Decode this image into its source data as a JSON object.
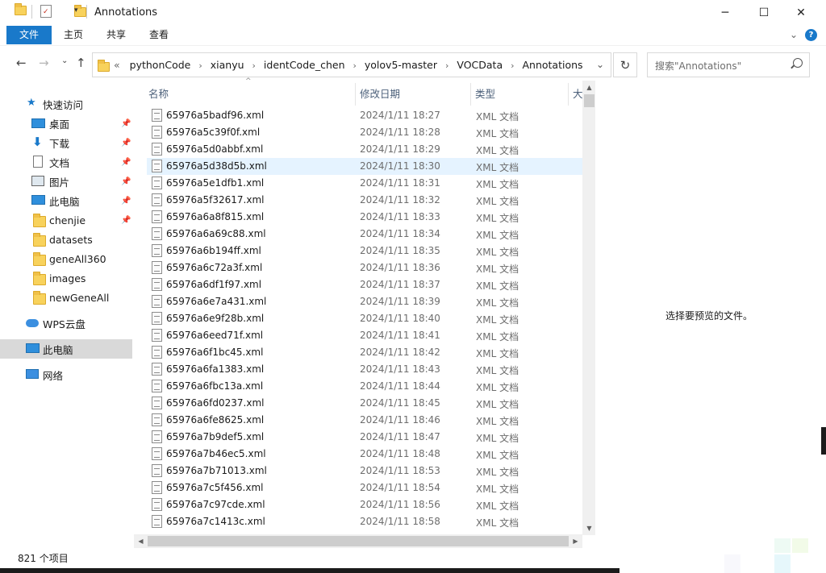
{
  "window": {
    "title": "Annotations",
    "minimize_icon": "─",
    "maximize_icon": "☐",
    "close_icon": "✕"
  },
  "ribbon": {
    "tabs": [
      "文件",
      "主页",
      "共享",
      "查看"
    ],
    "expand_icon": "⌄",
    "help_icon": "?"
  },
  "address": {
    "back_icon": "←",
    "forward_icon": "→",
    "recent_icon": "⌄",
    "up_icon": "↑",
    "overflow": "«",
    "crumbs": [
      "pythonCode",
      "xianyu",
      "identCode_chen",
      "yolov5-master",
      "VOCData",
      "Annotations"
    ],
    "dropdown_icon": "⌄",
    "refresh_icon": "↻"
  },
  "search": {
    "placeholder": "搜索\"Annotations\""
  },
  "nav": {
    "quick_access": "快速访问",
    "items": [
      {
        "label": "桌面",
        "pinned": true
      },
      {
        "label": "下载",
        "pinned": true
      },
      {
        "label": "文档",
        "pinned": true
      },
      {
        "label": "图片",
        "pinned": true
      },
      {
        "label": "此电脑",
        "pinned": true
      },
      {
        "label": "chenjie",
        "pinned": true
      },
      {
        "label": "datasets",
        "pinned": false
      },
      {
        "label": "geneAll360",
        "pinned": false
      },
      {
        "label": "images",
        "pinned": false
      },
      {
        "label": "newGeneAll",
        "pinned": false
      }
    ],
    "wps": "WPS云盘",
    "this_pc": "此电脑",
    "network": "网络",
    "pin_icon": "📌"
  },
  "columns": {
    "name": "名称",
    "date": "修改日期",
    "type": "类型",
    "size": "大"
  },
  "files": [
    {
      "name": "65976a5badf96.xml",
      "date": "2024/1/11 18:27",
      "type": "XML 文档"
    },
    {
      "name": "65976a5c39f0f.xml",
      "date": "2024/1/11 18:28",
      "type": "XML 文档"
    },
    {
      "name": "65976a5d0abbf.xml",
      "date": "2024/1/11 18:29",
      "type": "XML 文档"
    },
    {
      "name": "65976a5d38d5b.xml",
      "date": "2024/1/11 18:30",
      "type": "XML 文档",
      "highlight": true
    },
    {
      "name": "65976a5e1dfb1.xml",
      "date": "2024/1/11 18:31",
      "type": "XML 文档"
    },
    {
      "name": "65976a5f32617.xml",
      "date": "2024/1/11 18:32",
      "type": "XML 文档"
    },
    {
      "name": "65976a6a8f815.xml",
      "date": "2024/1/11 18:33",
      "type": "XML 文档"
    },
    {
      "name": "65976a6a69c88.xml",
      "date": "2024/1/11 18:34",
      "type": "XML 文档"
    },
    {
      "name": "65976a6b194ff.xml",
      "date": "2024/1/11 18:35",
      "type": "XML 文档"
    },
    {
      "name": "65976a6c72a3f.xml",
      "date": "2024/1/11 18:36",
      "type": "XML 文档"
    },
    {
      "name": "65976a6df1f97.xml",
      "date": "2024/1/11 18:37",
      "type": "XML 文档"
    },
    {
      "name": "65976a6e7a431.xml",
      "date": "2024/1/11 18:39",
      "type": "XML 文档"
    },
    {
      "name": "65976a6e9f28b.xml",
      "date": "2024/1/11 18:40",
      "type": "XML 文档"
    },
    {
      "name": "65976a6eed71f.xml",
      "date": "2024/1/11 18:41",
      "type": "XML 文档"
    },
    {
      "name": "65976a6f1bc45.xml",
      "date": "2024/1/11 18:42",
      "type": "XML 文档"
    },
    {
      "name": "65976a6fa1383.xml",
      "date": "2024/1/11 18:43",
      "type": "XML 文档"
    },
    {
      "name": "65976a6fbc13a.xml",
      "date": "2024/1/11 18:44",
      "type": "XML 文档"
    },
    {
      "name": "65976a6fd0237.xml",
      "date": "2024/1/11 18:45",
      "type": "XML 文档"
    },
    {
      "name": "65976a6fe8625.xml",
      "date": "2024/1/11 18:46",
      "type": "XML 文档"
    },
    {
      "name": "65976a7b9def5.xml",
      "date": "2024/1/11 18:47",
      "type": "XML 文档"
    },
    {
      "name": "65976a7b46ec5.xml",
      "date": "2024/1/11 18:48",
      "type": "XML 文档"
    },
    {
      "name": "65976a7b71013.xml",
      "date": "2024/1/11 18:53",
      "type": "XML 文档"
    },
    {
      "name": "65976a7c5f456.xml",
      "date": "2024/1/11 18:54",
      "type": "XML 文档"
    },
    {
      "name": "65976a7c97cde.xml",
      "date": "2024/1/11 18:56",
      "type": "XML 文档"
    },
    {
      "name": "65976a7c1413c.xml",
      "date": "2024/1/11 18:58",
      "type": "XML 文档"
    }
  ],
  "preview": {
    "message": "选择要预览的文件。"
  },
  "status": {
    "item_count": "821 个项目"
  },
  "colors": {
    "accent": "#1979ca",
    "selection": "#e5f3ff",
    "nav_selected": "#d9d9d9"
  }
}
